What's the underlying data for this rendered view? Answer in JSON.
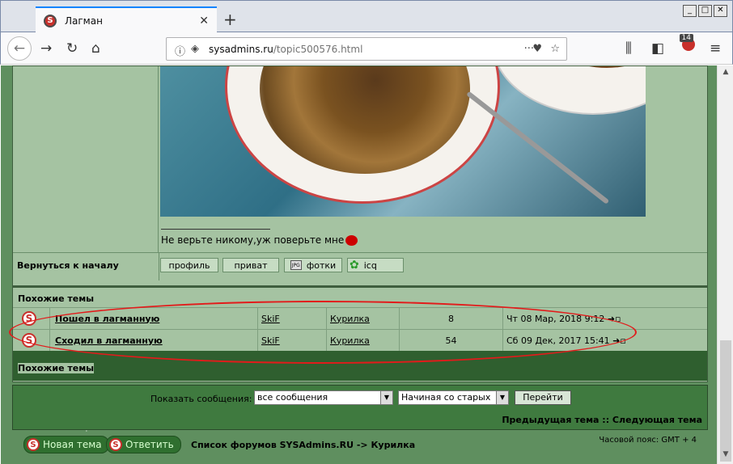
{
  "browser": {
    "tab_title": "Лагман",
    "url_domain": "sysadmins.ru",
    "url_path": "/topic500576.html",
    "badge_count": "14"
  },
  "post": {
    "signature": "Не верьте никому,уж поверьте мне",
    "back_to_top": "Вернуться к началу",
    "buttons": [
      "профиль",
      "приват",
      "фотки",
      "icq"
    ]
  },
  "similar": {
    "header": "Похожие темы",
    "footer": "Похожие темы",
    "rows": [
      {
        "title": "Пошел в лагманную",
        "author": "SkiF",
        "forum": "Курилка",
        "replies": "8",
        "date": "Чт 08 Мар, 2018 9:12"
      },
      {
        "title": "Сходил в лагманную",
        "author": "SkiF",
        "forum": "Курилка",
        "replies": "54",
        "date": "Сб 09 Дек, 2017 15:41"
      }
    ]
  },
  "controls": {
    "show_label": "Показать сообщения:",
    "filter_value": "все сообщения",
    "order_value": "Начиная со старых",
    "go_label": "Перейти",
    "prev_next": "Предыдущая тема :: Следующая тема"
  },
  "actions": {
    "new_topic": "Новая тема",
    "reply": "Ответить",
    "breadcrumbs": "Список форумов SYSAdmins.RU -> Курилка",
    "timezone": "Часовой пояс: GMT + 4"
  }
}
